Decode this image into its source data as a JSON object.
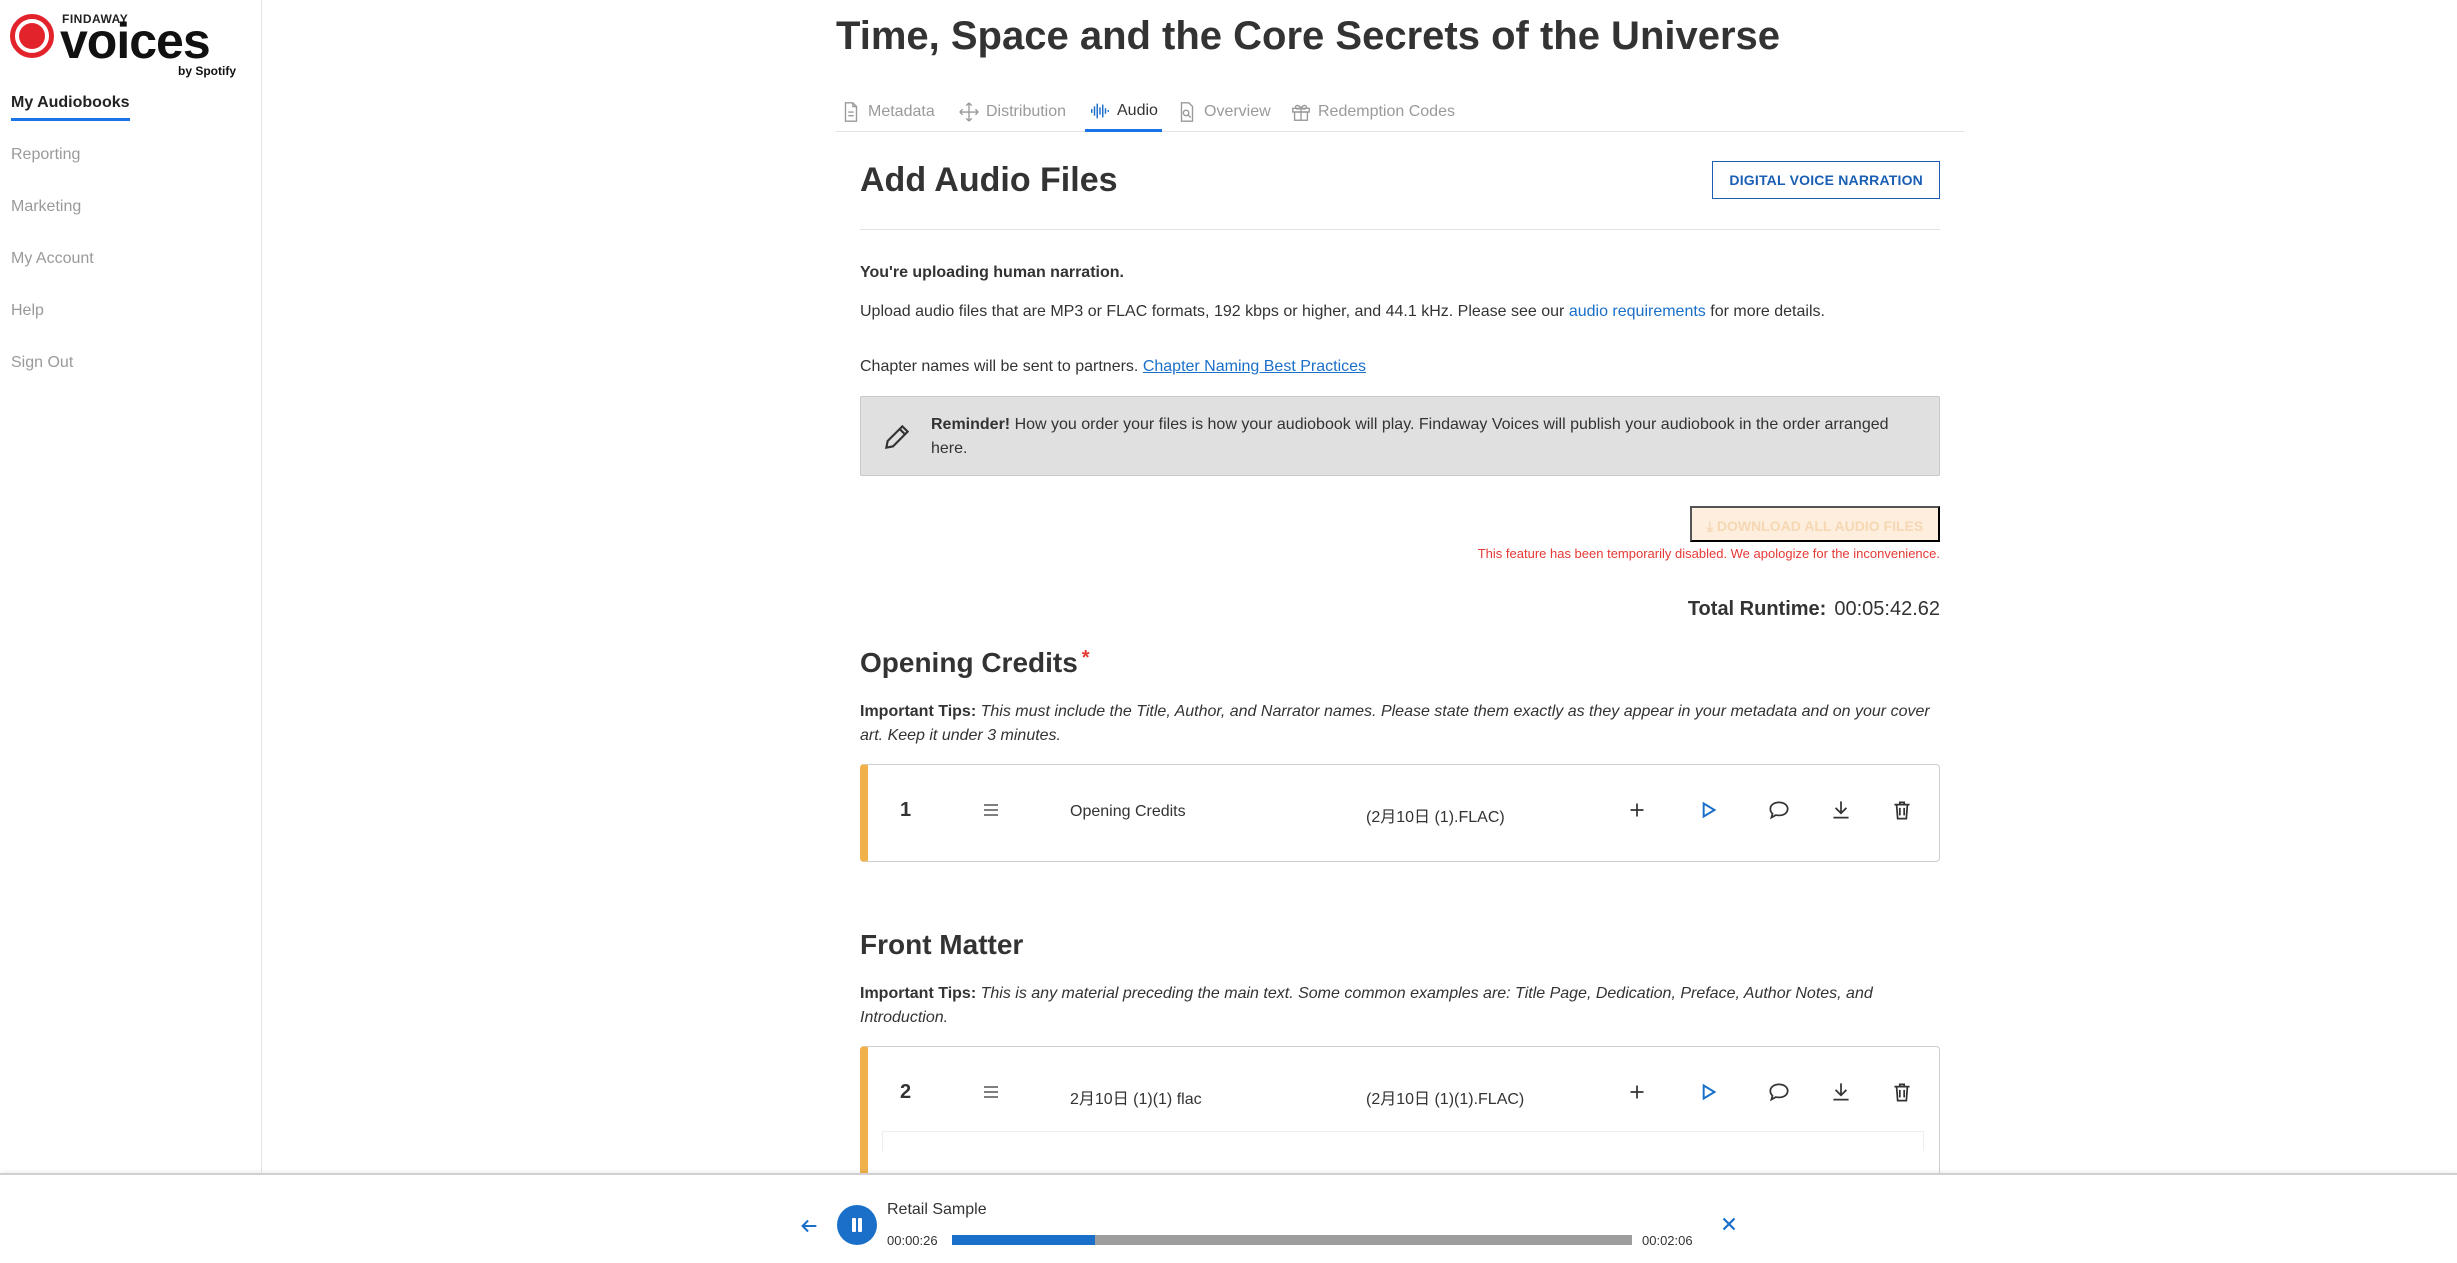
{
  "brand": {
    "top": "FINDAWAY",
    "main": "voices",
    "sub": "by Spotify",
    "accent": "#e3232c"
  },
  "sidebar": {
    "items": [
      {
        "label": "My Audiobooks",
        "active": true
      },
      {
        "label": "Reporting"
      },
      {
        "label": "Marketing"
      },
      {
        "label": "My Account"
      },
      {
        "label": "Help"
      },
      {
        "label": "Sign Out"
      }
    ]
  },
  "book": {
    "title": "Time, Space and the Core Secrets of the Universe"
  },
  "tabs": [
    {
      "label": "Metadata",
      "icon": "document-icon"
    },
    {
      "label": "Distribution",
      "icon": "arrows-icon"
    },
    {
      "label": "Audio",
      "icon": "waveform-icon",
      "active": true
    },
    {
      "label": "Overview",
      "icon": "magnifier-icon"
    },
    {
      "label": "Redemption Codes",
      "icon": "gift-icon"
    }
  ],
  "panel": {
    "title": "Add Audio Files",
    "dvn_button": "DIGITAL VOICE NARRATION",
    "uploading_note": "You're uploading human narration.",
    "upload_text_before": "Upload audio files that are MP3 or FLAC formats, 192 kbps or higher, and 44.1 kHz. Please see our ",
    "upload_link": "audio requirements",
    "upload_text_after": " for more details.",
    "chapter_text": "Chapter names will be sent to partners. ",
    "chapter_link": "Chapter Naming Best Practices",
    "reminder_label": "Reminder!",
    "reminder_text": " How you order your files is how your audiobook will play. Findaway Voices will publish your audiobook in the order arranged here.",
    "download_all": "⤓ DOWNLOAD ALL AUDIO FILES",
    "download_note": "This feature has been temporarily disabled. We apologize for the inconvenience.",
    "runtime_label": "Total Runtime:",
    "runtime_value": "00:05:42.62"
  },
  "sections": [
    {
      "title": "Opening Credits",
      "required_mark": "*",
      "tips_label": "Important Tips:",
      "tips_text": " This must include the Title, Author, and Narrator names. Please state them exactly as they appear in your metadata and on your cover art. Keep it under 3 minutes.",
      "track": {
        "number": "1",
        "name": "Opening Credits",
        "file": "(2月10日 (1).FLAC)"
      }
    },
    {
      "title": "Front Matter",
      "tips_label": "Important Tips:",
      "tips_text": " This is any material preceding the main text. Some common examples are: Title Page, Dedication, Preface, Author Notes, and Introduction.",
      "track": {
        "number": "2",
        "name": "2月10日 (1)(1) flac",
        "file": "(2月10日 (1)(1).FLAC)"
      }
    }
  ],
  "player": {
    "title": "Retail Sample",
    "current": "00:00:26",
    "total": "00:02:06",
    "progress_fraction": 0.21
  },
  "colors": {
    "primary": "#1a6fc9",
    "track_accent": "#f0b14a",
    "error": "#e53935"
  }
}
